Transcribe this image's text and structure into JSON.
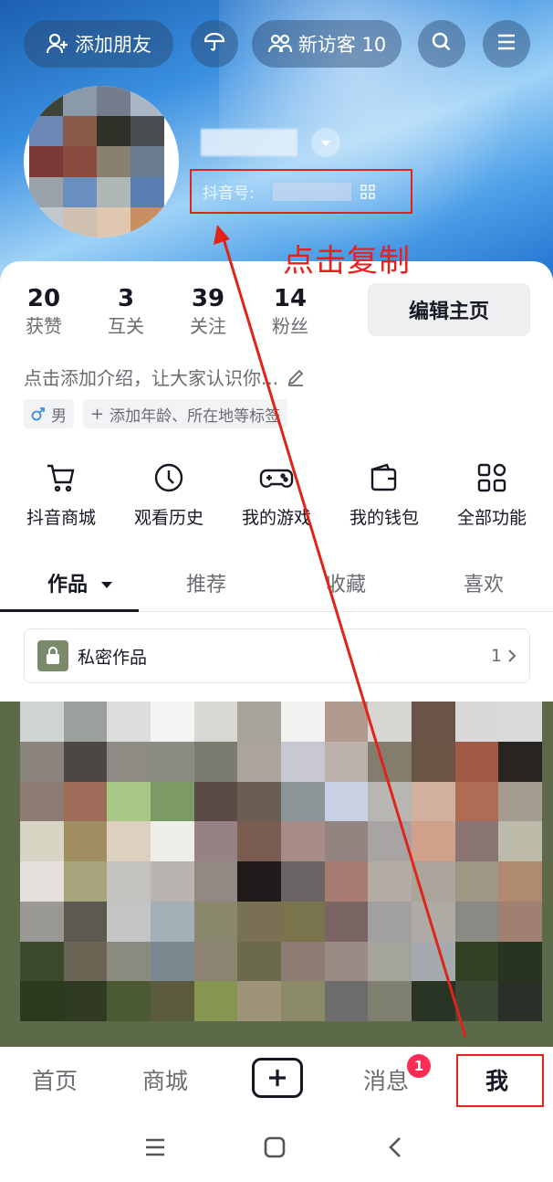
{
  "header": {
    "add_friend": "添加朋友",
    "visitors": "新访客 10",
    "douyin_id_label": "抖音号:",
    "copy_annotation": "点击复制"
  },
  "stats": [
    {
      "num": "20",
      "label": "获赞"
    },
    {
      "num": "3",
      "label": "互关"
    },
    {
      "num": "39",
      "label": "关注"
    },
    {
      "num": "14",
      "label": "粉丝"
    }
  ],
  "edit_profile": "编辑主页",
  "bio": "点击添加介绍，让大家认识你...",
  "tags": {
    "gender": "男",
    "add_tags": "添加年龄、所在地等标签"
  },
  "shortcuts": [
    {
      "label": "抖音商城",
      "icon": "cart-icon"
    },
    {
      "label": "观看历史",
      "icon": "clock-icon"
    },
    {
      "label": "我的游戏",
      "icon": "gamepad-icon"
    },
    {
      "label": "我的钱包",
      "icon": "wallet-icon"
    },
    {
      "label": "全部功能",
      "icon": "grid-icon"
    }
  ],
  "tabs": [
    "作品",
    "推荐",
    "收藏",
    "喜欢"
  ],
  "private_works": {
    "label": "私密作品",
    "count": "1"
  },
  "bottom_nav": {
    "home": "首页",
    "mall": "商城",
    "messages": "消息",
    "messages_badge": "1",
    "me": "我"
  },
  "colors": {
    "annotation_red": "#e0241a",
    "badge": "#fe2c55"
  }
}
